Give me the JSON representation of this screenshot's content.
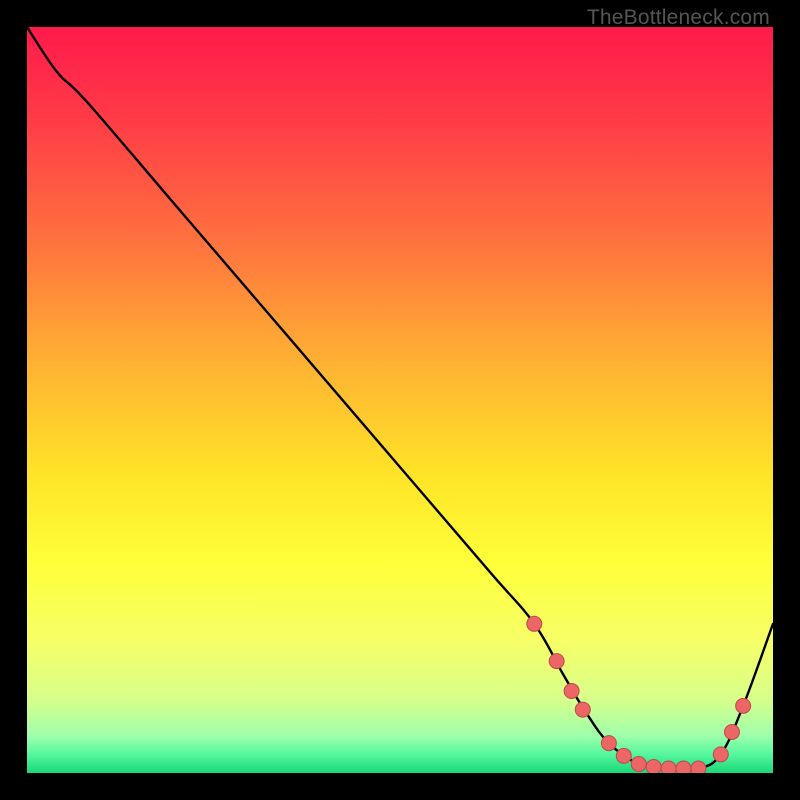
{
  "attribution": "TheBottleneck.com",
  "chart_data": {
    "type": "line",
    "title": "",
    "xlabel": "",
    "ylabel": "",
    "xlim": [
      0,
      100
    ],
    "ylim": [
      0,
      100
    ],
    "gradient_stops": [
      {
        "offset": 0.0,
        "color": "#ff1a4b"
      },
      {
        "offset": 0.12,
        "color": "#ff3a47"
      },
      {
        "offset": 0.28,
        "color": "#ff6f3f"
      },
      {
        "offset": 0.44,
        "color": "#ffae34"
      },
      {
        "offset": 0.6,
        "color": "#ffe427"
      },
      {
        "offset": 0.72,
        "color": "#ffff3a"
      },
      {
        "offset": 0.82,
        "color": "#f7ff66"
      },
      {
        "offset": 0.9,
        "color": "#d8ff8a"
      },
      {
        "offset": 0.95,
        "color": "#9fffab"
      },
      {
        "offset": 0.975,
        "color": "#55f79e"
      },
      {
        "offset": 1.0,
        "color": "#18d878"
      }
    ],
    "series": [
      {
        "name": "curve",
        "stroke": "#000000",
        "x": [
          0,
          4,
          8,
          20,
          35,
          50,
          62,
          68,
          72,
          75,
          78,
          82,
          86,
          90,
          93,
          96,
          100
        ],
        "y": [
          100,
          94,
          90,
          76,
          58.5,
          41,
          27,
          20,
          13,
          8,
          4,
          1.2,
          0.6,
          0.6,
          2.5,
          9,
          20
        ]
      }
    ],
    "markers": {
      "fill": "#ec6666",
      "stroke": "#bc4a4a",
      "r": 7.5,
      "points": [
        {
          "x": 68,
          "y": 20
        },
        {
          "x": 71,
          "y": 15
        },
        {
          "x": 73,
          "y": 11
        },
        {
          "x": 74.5,
          "y": 8.5
        },
        {
          "x": 78,
          "y": 4
        },
        {
          "x": 80,
          "y": 2.3
        },
        {
          "x": 82,
          "y": 1.2
        },
        {
          "x": 84,
          "y": 0.8
        },
        {
          "x": 86,
          "y": 0.6
        },
        {
          "x": 88,
          "y": 0.6
        },
        {
          "x": 90,
          "y": 0.6
        },
        {
          "x": 93,
          "y": 2.5
        },
        {
          "x": 94.5,
          "y": 5.5
        },
        {
          "x": 96,
          "y": 9
        }
      ]
    }
  }
}
